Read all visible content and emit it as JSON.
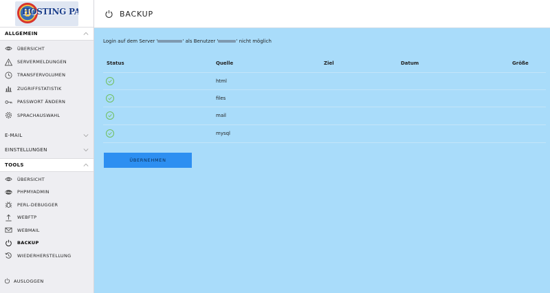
{
  "logo": {
    "text": "HOSTING PANEL"
  },
  "sidebar": {
    "sections": {
      "allgemein": {
        "title": "ALLGEMEIN",
        "items": [
          {
            "label": "ÜBERSICHT",
            "icon": "eye-icon"
          },
          {
            "label": "SERVERMELDUNGEN",
            "icon": "warning-icon"
          },
          {
            "label": "TRANSFERVOLUMEN",
            "icon": "clock-icon"
          },
          {
            "label": "ZUGRIFFSTATISTIK",
            "icon": "bar-chart-icon"
          },
          {
            "label": "PASSWORT ÄNDERN",
            "icon": "key-icon"
          },
          {
            "label": "SPRACHAUSWAHL",
            "icon": "gear-icon"
          }
        ]
      },
      "email": {
        "title": "E-MAIL"
      },
      "einstellungen": {
        "title": "EINSTELLUNGEN"
      },
      "tools": {
        "title": "TOOLS",
        "items": [
          {
            "label": "ÜBERSICHT",
            "icon": "eye-icon"
          },
          {
            "label": "PHPMYADMIN",
            "icon": "pma-icon"
          },
          {
            "label": "PERL-DEBUGGER",
            "icon": "bug-icon"
          },
          {
            "label": "WEBFTP",
            "icon": "upload-icon"
          },
          {
            "label": "WEBMAIL",
            "icon": "envelope-icon"
          },
          {
            "label": "BACKUP",
            "icon": "power-icon",
            "active": true
          },
          {
            "label": "WIEDERHERSTELLUNG",
            "icon": "restore-icon"
          }
        ]
      }
    },
    "logout": {
      "label": "AUSLOGGEN",
      "icon": "power-icon"
    }
  },
  "header": {
    "title": "BACKUP",
    "icon": "power-icon"
  },
  "notice": {
    "part1": "Login auf dem Server '",
    "part2": "' als Benutzer '",
    "part3": "' nicht möglich"
  },
  "table": {
    "headers": {
      "status": "Status",
      "quelle": "Quelle",
      "ziel": "Ziel",
      "datum": "Datum",
      "groesse": "Größe"
    },
    "rows": [
      {
        "quelle": "html"
      },
      {
        "quelle": "files"
      },
      {
        "quelle": "mail"
      },
      {
        "quelle": "mysql"
      }
    ]
  },
  "apply_button": {
    "label": "ÜBERNEHMEN"
  },
  "colors": {
    "main_bg": "#a9dcfa",
    "sidebar_bg": "#eeeef2",
    "button_bg": "#2d8ff1",
    "status_ok": "#6fbf5c"
  }
}
